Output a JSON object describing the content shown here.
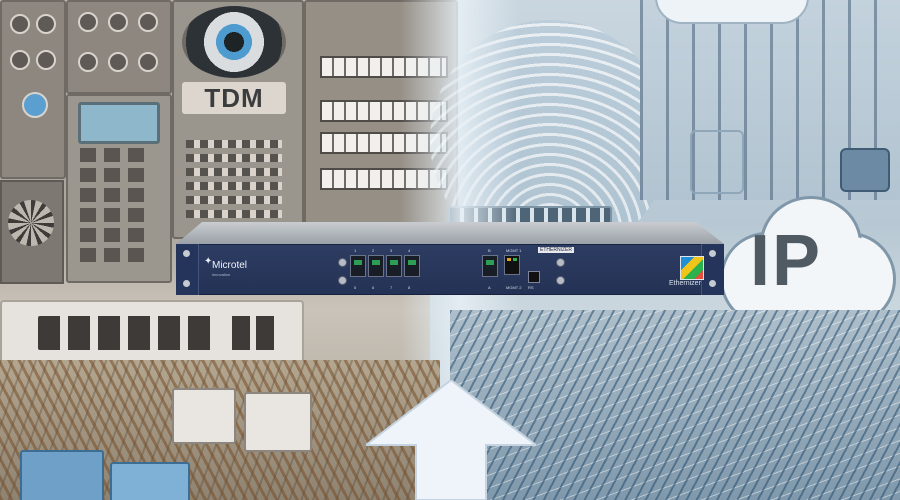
{
  "scene": {
    "left_theme_label": "TDM",
    "right_theme_label": "IP"
  },
  "device": {
    "brand": "Microtel",
    "brand_sub": "innovation",
    "product_name": "Ethernizer",
    "port_numbers": [
      "1",
      "2",
      "3",
      "4",
      "5",
      "6",
      "7",
      "8"
    ],
    "port_numbers_bottom": [
      "1",
      "2",
      "3",
      "4",
      "5",
      "6",
      "7",
      "8"
    ],
    "mgmt_labels": [
      "MGMT 1",
      "MGMT 2"
    ],
    "right_port_labels": [
      "B",
      "A"
    ],
    "console_label": "RS",
    "tag_text": "ETHERNIZER"
  },
  "colors": {
    "device_face": "#2d3c62",
    "legacy_tone": "#a9a49c",
    "ip_tone": "#b7c8d4",
    "sfp_led": "#2d9e56"
  },
  "icons": [
    "fan-icon",
    "cloud-icon",
    "arrow-up-icon",
    "brand-logo-icon",
    "ethernizer-logo-icon"
  ]
}
